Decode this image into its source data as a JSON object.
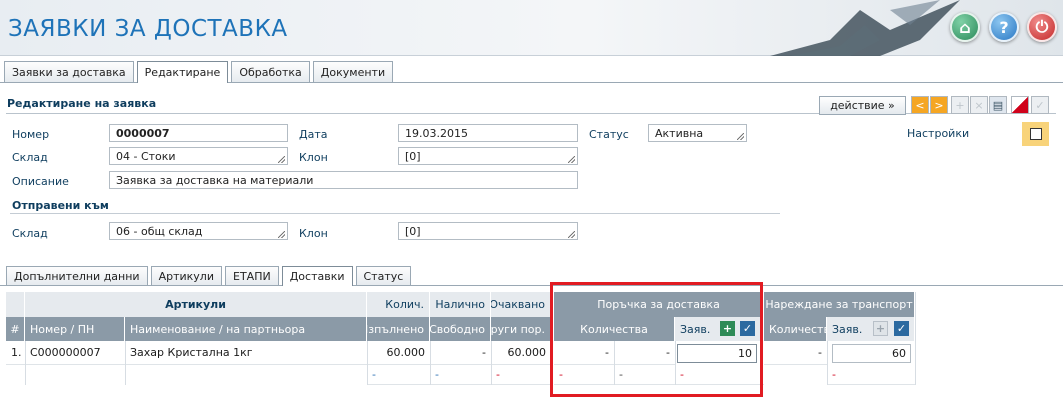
{
  "app": {
    "title": "ЗАЯВКИ ЗА ДОСТАВКА"
  },
  "header_buttons": {
    "home_icon": "⌂",
    "help_icon": "?",
    "power_icon": "⏻"
  },
  "top_tabs": [
    {
      "label": "Заявки за доставка"
    },
    {
      "label": "Редактиране"
    },
    {
      "label": "Обработка"
    },
    {
      "label": "Документи"
    }
  ],
  "section": {
    "title": "Редактиране на заявка"
  },
  "toolbar": {
    "action_label": "действие »",
    "prev": "<",
    "next": ">",
    "add": "+",
    "del": "×",
    "print": "▤",
    "ok": "✓"
  },
  "form": {
    "number_label": "Номер",
    "number": "0000007",
    "date_label": "Дата",
    "date": "19.03.2015",
    "status_label": "Статус",
    "status": "Активна",
    "warehouse_label": "Склад",
    "warehouse": "04 - Стоки",
    "branch_label": "Клон",
    "branch": "[0]",
    "description_label": "Описание",
    "description": "Заявка за доставка на материали",
    "settings_label": "Настройки",
    "sent_to_title": "Отправени към",
    "to_warehouse_label": "Склад",
    "to_warehouse": "06 - общ склад",
    "to_branch_label": "Клон",
    "to_branch": "[0]"
  },
  "inner_tabs": [
    {
      "label": "Допълнителни данни"
    },
    {
      "label": "Артикули"
    },
    {
      "label": "ЕТАПИ"
    },
    {
      "label": "Доставки"
    },
    {
      "label": "Статус"
    }
  ],
  "grid": {
    "group_headers": {
      "articles": "Артикули",
      "qty": "Колич.",
      "available": "Налично",
      "expected": "Очаквано",
      "purchase_order": "Поръчка за доставка",
      "transport": "Нареждане за транспорт"
    },
    "sub_headers": {
      "num": "#",
      "number_pn": "Номер / ПН",
      "name_partner": "Наименование / на партньора",
      "fulfilled": "Изпълнено",
      "free": "Свободно",
      "other_orders": "Други пор.",
      "po_quantities": "Количества",
      "po_requested": "Заяв.",
      "tr_quantities": "Количества",
      "tr_requested": "Заяв."
    },
    "rows": [
      {
        "idx": "1.",
        "number": "C000000007",
        "name": "Захар Кристална 1кг",
        "qty": "60.000",
        "available": "-",
        "expected": "60.000",
        "po_q1": "-",
        "po_q2": "-",
        "po_req": "10",
        "tr_q": "-",
        "tr_req": "60"
      }
    ],
    "subrow": {
      "c4": "-",
      "c5": "-",
      "c6": "-",
      "c7": "-",
      "c8": "-",
      "c9": "-",
      "c10": "-"
    }
  },
  "colors": {
    "accent": "#1e73b8",
    "highlight": "#e11b22",
    "tab_border": "#9aa8b4"
  }
}
